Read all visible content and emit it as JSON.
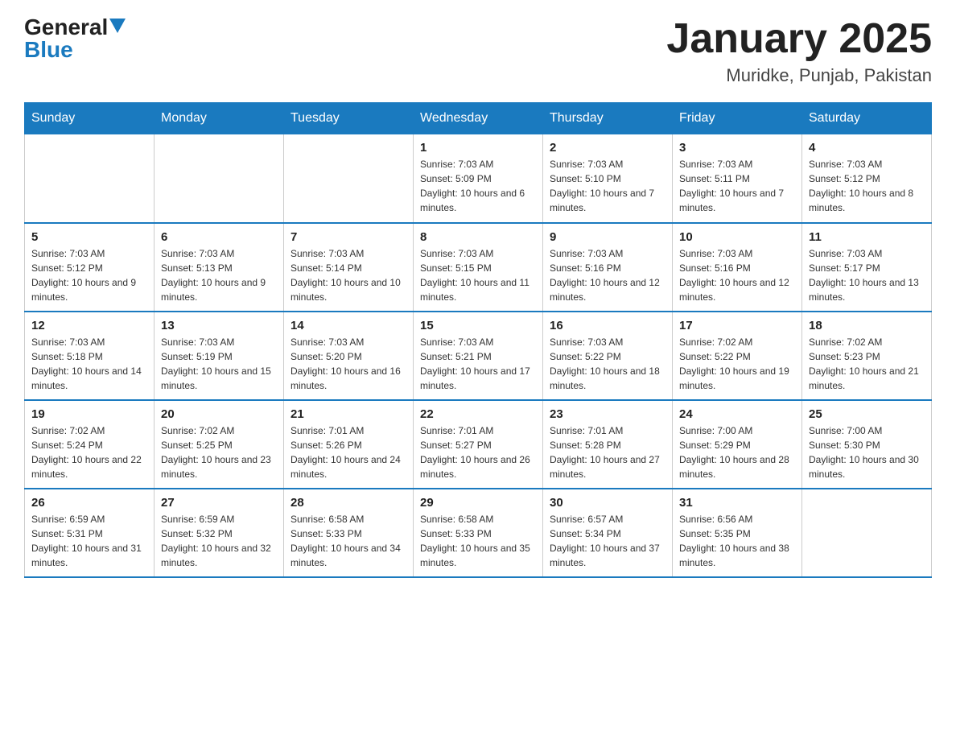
{
  "header": {
    "logo_general": "General",
    "logo_blue": "Blue",
    "month_title": "January 2025",
    "location": "Muridke, Punjab, Pakistan"
  },
  "weekdays": [
    "Sunday",
    "Monday",
    "Tuesday",
    "Wednesday",
    "Thursday",
    "Friday",
    "Saturday"
  ],
  "weeks": [
    [
      {
        "day": "",
        "info": ""
      },
      {
        "day": "",
        "info": ""
      },
      {
        "day": "",
        "info": ""
      },
      {
        "day": "1",
        "info": "Sunrise: 7:03 AM\nSunset: 5:09 PM\nDaylight: 10 hours and 6 minutes."
      },
      {
        "day": "2",
        "info": "Sunrise: 7:03 AM\nSunset: 5:10 PM\nDaylight: 10 hours and 7 minutes."
      },
      {
        "day": "3",
        "info": "Sunrise: 7:03 AM\nSunset: 5:11 PM\nDaylight: 10 hours and 7 minutes."
      },
      {
        "day": "4",
        "info": "Sunrise: 7:03 AM\nSunset: 5:12 PM\nDaylight: 10 hours and 8 minutes."
      }
    ],
    [
      {
        "day": "5",
        "info": "Sunrise: 7:03 AM\nSunset: 5:12 PM\nDaylight: 10 hours and 9 minutes."
      },
      {
        "day": "6",
        "info": "Sunrise: 7:03 AM\nSunset: 5:13 PM\nDaylight: 10 hours and 9 minutes."
      },
      {
        "day": "7",
        "info": "Sunrise: 7:03 AM\nSunset: 5:14 PM\nDaylight: 10 hours and 10 minutes."
      },
      {
        "day": "8",
        "info": "Sunrise: 7:03 AM\nSunset: 5:15 PM\nDaylight: 10 hours and 11 minutes."
      },
      {
        "day": "9",
        "info": "Sunrise: 7:03 AM\nSunset: 5:16 PM\nDaylight: 10 hours and 12 minutes."
      },
      {
        "day": "10",
        "info": "Sunrise: 7:03 AM\nSunset: 5:16 PM\nDaylight: 10 hours and 12 minutes."
      },
      {
        "day": "11",
        "info": "Sunrise: 7:03 AM\nSunset: 5:17 PM\nDaylight: 10 hours and 13 minutes."
      }
    ],
    [
      {
        "day": "12",
        "info": "Sunrise: 7:03 AM\nSunset: 5:18 PM\nDaylight: 10 hours and 14 minutes."
      },
      {
        "day": "13",
        "info": "Sunrise: 7:03 AM\nSunset: 5:19 PM\nDaylight: 10 hours and 15 minutes."
      },
      {
        "day": "14",
        "info": "Sunrise: 7:03 AM\nSunset: 5:20 PM\nDaylight: 10 hours and 16 minutes."
      },
      {
        "day": "15",
        "info": "Sunrise: 7:03 AM\nSunset: 5:21 PM\nDaylight: 10 hours and 17 minutes."
      },
      {
        "day": "16",
        "info": "Sunrise: 7:03 AM\nSunset: 5:22 PM\nDaylight: 10 hours and 18 minutes."
      },
      {
        "day": "17",
        "info": "Sunrise: 7:02 AM\nSunset: 5:22 PM\nDaylight: 10 hours and 19 minutes."
      },
      {
        "day": "18",
        "info": "Sunrise: 7:02 AM\nSunset: 5:23 PM\nDaylight: 10 hours and 21 minutes."
      }
    ],
    [
      {
        "day": "19",
        "info": "Sunrise: 7:02 AM\nSunset: 5:24 PM\nDaylight: 10 hours and 22 minutes."
      },
      {
        "day": "20",
        "info": "Sunrise: 7:02 AM\nSunset: 5:25 PM\nDaylight: 10 hours and 23 minutes."
      },
      {
        "day": "21",
        "info": "Sunrise: 7:01 AM\nSunset: 5:26 PM\nDaylight: 10 hours and 24 minutes."
      },
      {
        "day": "22",
        "info": "Sunrise: 7:01 AM\nSunset: 5:27 PM\nDaylight: 10 hours and 26 minutes."
      },
      {
        "day": "23",
        "info": "Sunrise: 7:01 AM\nSunset: 5:28 PM\nDaylight: 10 hours and 27 minutes."
      },
      {
        "day": "24",
        "info": "Sunrise: 7:00 AM\nSunset: 5:29 PM\nDaylight: 10 hours and 28 minutes."
      },
      {
        "day": "25",
        "info": "Sunrise: 7:00 AM\nSunset: 5:30 PM\nDaylight: 10 hours and 30 minutes."
      }
    ],
    [
      {
        "day": "26",
        "info": "Sunrise: 6:59 AM\nSunset: 5:31 PM\nDaylight: 10 hours and 31 minutes."
      },
      {
        "day": "27",
        "info": "Sunrise: 6:59 AM\nSunset: 5:32 PM\nDaylight: 10 hours and 32 minutes."
      },
      {
        "day": "28",
        "info": "Sunrise: 6:58 AM\nSunset: 5:33 PM\nDaylight: 10 hours and 34 minutes."
      },
      {
        "day": "29",
        "info": "Sunrise: 6:58 AM\nSunset: 5:33 PM\nDaylight: 10 hours and 35 minutes."
      },
      {
        "day": "30",
        "info": "Sunrise: 6:57 AM\nSunset: 5:34 PM\nDaylight: 10 hours and 37 minutes."
      },
      {
        "day": "31",
        "info": "Sunrise: 6:56 AM\nSunset: 5:35 PM\nDaylight: 10 hours and 38 minutes."
      },
      {
        "day": "",
        "info": ""
      }
    ]
  ]
}
